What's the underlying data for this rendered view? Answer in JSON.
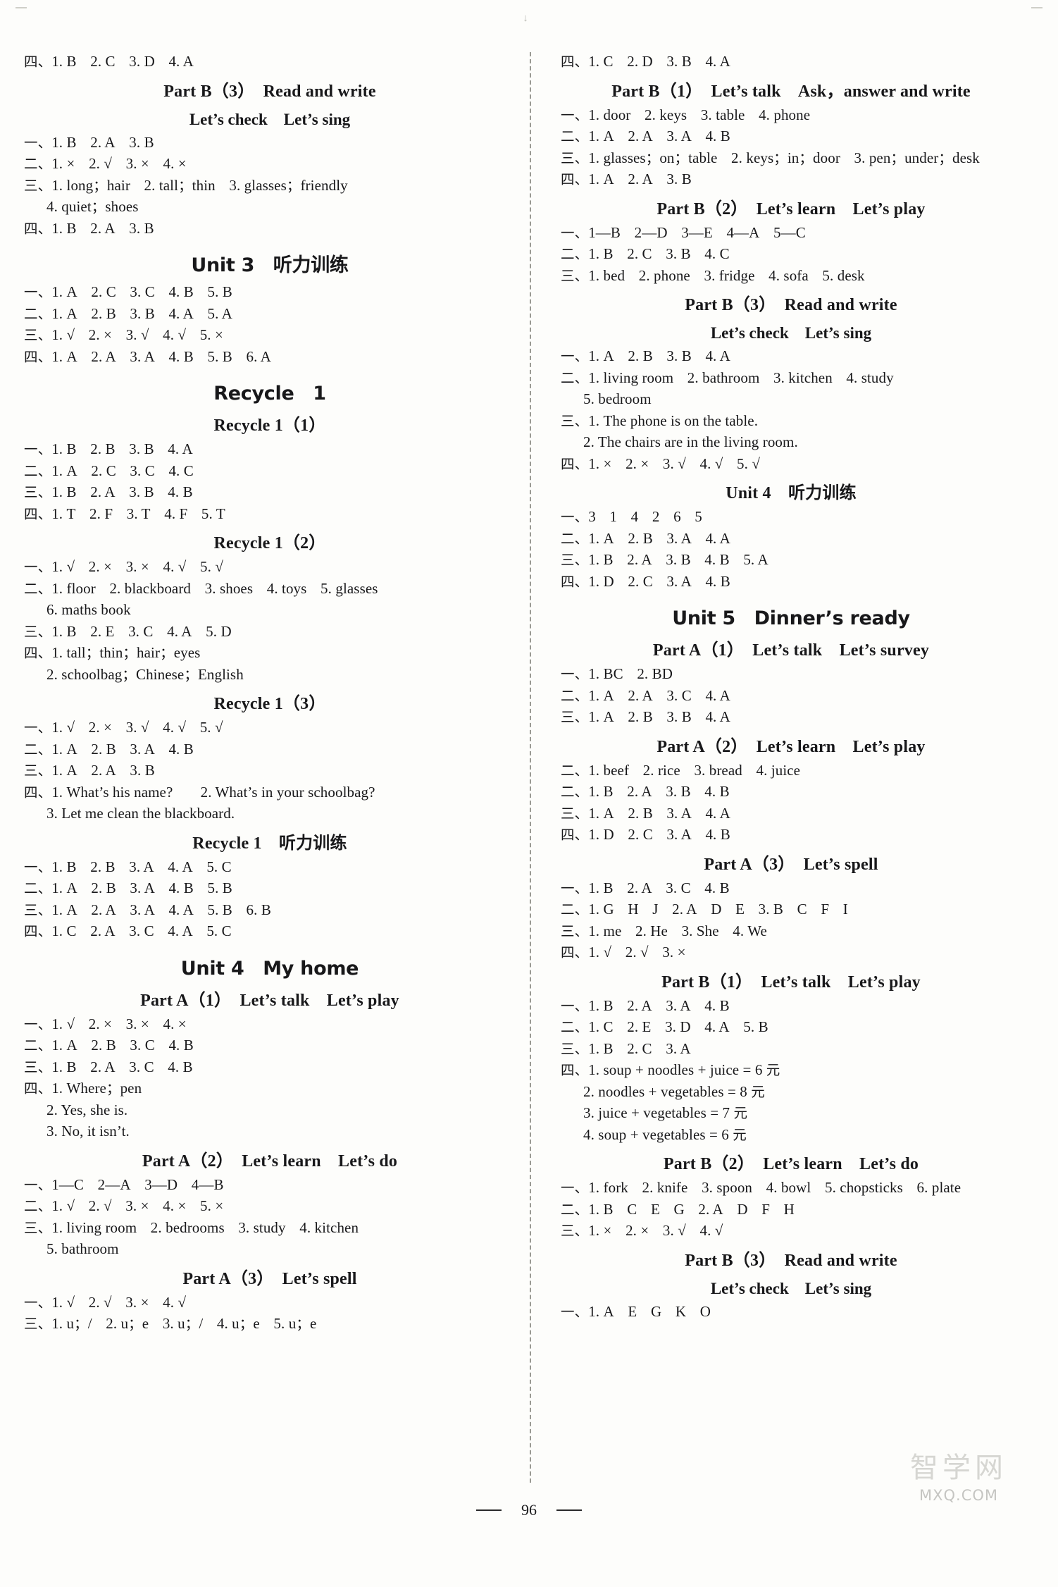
{
  "page": {
    "number": "96",
    "top_mark": "↓",
    "watermark_cn": "智学网",
    "watermark_url": "MXQ.COM"
  },
  "left_column": [
    {
      "kind": "answer",
      "text": "四、1. B　2. C　3. D　4. A"
    },
    {
      "kind": "heading_part",
      "text": "Part B（3）　Read and write"
    },
    {
      "kind": "heading_sub",
      "text": "Let’s check　Let’s sing"
    },
    {
      "kind": "answer",
      "text": "一、1. B　2. A　3. B"
    },
    {
      "kind": "answer",
      "text": "二、1. ×　2. √　3. ×　4. ×"
    },
    {
      "kind": "answer",
      "text": "三、1. long；hair　2. tall；thin　3. glasses；friendly"
    },
    {
      "kind": "answer_indent",
      "text": "4. quiet；shoes"
    },
    {
      "kind": "answer",
      "text": "四、1. B　2. A　3. B"
    },
    {
      "kind": "heading_unit",
      "text": "Unit 3　听力训练"
    },
    {
      "kind": "answer",
      "text": "一、1. A　2. C　3. C　4. B　5. B"
    },
    {
      "kind": "answer",
      "text": "二、1. A　2. B　3. B　4. A　5. A"
    },
    {
      "kind": "answer",
      "text": "三、1. √　2. ×　3. √　4. √　5. ×"
    },
    {
      "kind": "answer",
      "text": "四、1. A　2. A　3. A　4. B　5. B　6. A"
    },
    {
      "kind": "heading_unit",
      "text": "Recycle　1"
    },
    {
      "kind": "heading_part",
      "text": "Recycle 1（1）"
    },
    {
      "kind": "answer",
      "text": "一、1. B　2. B　3. B　4. A"
    },
    {
      "kind": "answer",
      "text": "二、1. A　2. C　3. C　4. C"
    },
    {
      "kind": "answer",
      "text": "三、1. B　2. A　3. B　4. B"
    },
    {
      "kind": "answer",
      "text": "四、1. T　2. F　3. T　4. F　5. T"
    },
    {
      "kind": "heading_part",
      "text": "Recycle 1（2）"
    },
    {
      "kind": "answer",
      "text": "一、1. √　2. ×　3. ×　4. √　5. √"
    },
    {
      "kind": "answer",
      "text": "二、1. floor　2. blackboard　3. shoes　4. toys　5. glasses"
    },
    {
      "kind": "answer_indent",
      "text": "6. maths book"
    },
    {
      "kind": "answer",
      "text": "三、1. B　2. E　3. C　4. A　5. D"
    },
    {
      "kind": "answer",
      "text": "四、1. tall；thin；hair；eyes"
    },
    {
      "kind": "answer_indent",
      "text": "2. schoolbag；Chinese；English"
    },
    {
      "kind": "heading_part",
      "text": "Recycle 1（3）"
    },
    {
      "kind": "answer",
      "text": "一、1. √　2. ×　3. √　4. √　5. √"
    },
    {
      "kind": "answer",
      "text": "二、1. A　2. B　3. A　4. B"
    },
    {
      "kind": "answer",
      "text": "三、1. A　2. A　3. B"
    },
    {
      "kind": "answer",
      "text": "四、1. What’s his name?　　2. What’s in your schoolbag?"
    },
    {
      "kind": "answer_indent",
      "text": "3. Let me clean the blackboard."
    },
    {
      "kind": "heading_part",
      "text": "Recycle 1　听力训练"
    },
    {
      "kind": "answer",
      "text": "一、1. B　2. B　3. A　4. A　5. C"
    },
    {
      "kind": "answer",
      "text": "二、1. A　2. B　3. A　4. B　5. B"
    },
    {
      "kind": "answer",
      "text": "三、1. A　2. A　3. A　4. A　5. B　6. B"
    },
    {
      "kind": "answer",
      "text": "四、1. C　2. A　3. C　4. A　5. C"
    },
    {
      "kind": "heading_unit",
      "text": "Unit 4　My home"
    },
    {
      "kind": "heading_part",
      "text": "Part A（1）　Let’s talk　Let’s play"
    },
    {
      "kind": "answer",
      "text": "一、1. √　2. ×　3. ×　4. ×"
    },
    {
      "kind": "answer",
      "text": "二、1. A　2. B　3. C　4. B"
    },
    {
      "kind": "answer",
      "text": "三、1. B　2. A　3. C　4. B"
    },
    {
      "kind": "answer",
      "text": "四、1. Where；pen"
    },
    {
      "kind": "answer_indent",
      "text": "2. Yes, she is."
    },
    {
      "kind": "answer_indent",
      "text": "3. No, it isn’t."
    },
    {
      "kind": "heading_part",
      "text": "Part A（2）　Let’s learn　Let’s do"
    },
    {
      "kind": "answer",
      "text": "一、1—C　2—A　3—D　4—B"
    },
    {
      "kind": "answer",
      "text": "二、1. √　2. √　3. ×　4. ×　5. ×"
    },
    {
      "kind": "answer",
      "text": "三、1. living room　2. bedrooms　3. study　4. kitchen"
    },
    {
      "kind": "answer_indent",
      "text": "5. bathroom"
    },
    {
      "kind": "heading_part",
      "text": "Part A（3）　Let’s spell"
    },
    {
      "kind": "answer",
      "text": "一、1. √　2. √　3. ×　4. √"
    },
    {
      "kind": "answer",
      "text": "三、1. u；/　2. u；e　3. u；/　4. u；e　5. u；e"
    }
  ],
  "right_column": [
    {
      "kind": "answer",
      "text": "四、1. C　2. D　3. B　4. A"
    },
    {
      "kind": "heading_part",
      "text": "Part B（1）　Let’s talk　Ask，answer and write"
    },
    {
      "kind": "answer",
      "text": "一、1. door　2. keys　3. table　4. phone"
    },
    {
      "kind": "answer",
      "text": "二、1. A　2. A　3. A　4. B"
    },
    {
      "kind": "answer",
      "text": "三、1. glasses；on；table　2. keys；in；door　3. pen；under；desk"
    },
    {
      "kind": "answer",
      "text": "四、1. A　2. A　3. B"
    },
    {
      "kind": "heading_part",
      "text": "Part B（2）　Let’s learn　Let’s play"
    },
    {
      "kind": "answer",
      "text": "一、1—B　2—D　3—E　4—A　5—C"
    },
    {
      "kind": "answer",
      "text": "二、1. B　2. C　3. B　4. C"
    },
    {
      "kind": "answer",
      "text": "三、1. bed　2. phone　3. fridge　4. sofa　5. desk"
    },
    {
      "kind": "heading_part",
      "text": "Part B（3）　Read and write"
    },
    {
      "kind": "heading_sub",
      "text": "Let’s check　Let’s sing"
    },
    {
      "kind": "answer",
      "text": "一、1. A　2. B　3. B　4. A"
    },
    {
      "kind": "answer",
      "text": "二、1. living room　2. bathroom　3. kitchen　4. study"
    },
    {
      "kind": "answer_indent",
      "text": "5. bedroom"
    },
    {
      "kind": "answer",
      "text": "三、1. The phone is on the table."
    },
    {
      "kind": "answer_indent",
      "text": "2. The chairs are in the living room."
    },
    {
      "kind": "answer",
      "text": "四、1. ×　2. ×　3. √　4. √　5. √"
    },
    {
      "kind": "heading_part",
      "text": "Unit 4　听力训练"
    },
    {
      "kind": "answer",
      "text": "一、3　1　4　2　6　5"
    },
    {
      "kind": "answer",
      "text": "二、1. A　2. B　3. A　4. A"
    },
    {
      "kind": "answer",
      "text": "三、1. B　2. A　3. B　4. B　5. A"
    },
    {
      "kind": "answer",
      "text": "四、1. D　2. C　3. A　4. B"
    },
    {
      "kind": "heading_unit",
      "text": "Unit 5　Dinner’s ready"
    },
    {
      "kind": "heading_part",
      "text": "Part A（1）　Let’s talk　Let’s survey"
    },
    {
      "kind": "answer",
      "text": "一、1. BC　2. BD"
    },
    {
      "kind": "answer",
      "text": "二、1. A　2. A　3. C　4. A"
    },
    {
      "kind": "answer",
      "text": "三、1. A　2. B　3. B　4. A"
    },
    {
      "kind": "heading_part",
      "text": "Part A（2）　Let’s learn　Let’s play"
    },
    {
      "kind": "answer",
      "text": "二、1. beef　2. rice　3. bread　4. juice"
    },
    {
      "kind": "answer",
      "text": "二、1. B　2. A　3. B　4. B"
    },
    {
      "kind": "answer",
      "text": "三、1. A　2. B　3. A　4. A"
    },
    {
      "kind": "answer",
      "text": "四、1. D　2. C　3. A　4. B"
    },
    {
      "kind": "heading_part",
      "text": "Part A（3）　Let’s spell"
    },
    {
      "kind": "answer",
      "text": "一、1. B　2. A　3. C　4. B"
    },
    {
      "kind": "answer",
      "text": "二、1. G　H　J　2. A　D　E　3. B　C　F　I"
    },
    {
      "kind": "answer",
      "text": "三、1. me　2. He　3. She　4. We"
    },
    {
      "kind": "answer",
      "text": "四、1. √　2. √　3. ×"
    },
    {
      "kind": "heading_part",
      "text": "Part B（1）　Let’s talk　Let’s play"
    },
    {
      "kind": "answer",
      "text": "一、1. B　2. A　3. A　4. B"
    },
    {
      "kind": "answer",
      "text": "二、1. C　2. E　3. D　4. A　5. B"
    },
    {
      "kind": "answer",
      "text": "三、1. B　2. C　3. A"
    },
    {
      "kind": "answer",
      "text": "四、1. soup + noodles + juice = 6 元"
    },
    {
      "kind": "answer_indent",
      "text": "2. noodles + vegetables = 8 元"
    },
    {
      "kind": "answer_indent",
      "text": "3. juice + vegetables = 7 元"
    },
    {
      "kind": "answer_indent",
      "text": "4. soup + vegetables = 6 元"
    },
    {
      "kind": "heading_part",
      "text": "Part B（2）　Let’s learn　Let’s do"
    },
    {
      "kind": "answer",
      "text": "一、1. fork　2. knife　3. spoon　4. bowl　5. chopsticks　6. plate"
    },
    {
      "kind": "answer",
      "text": "二、1. B　C　E　G　2. A　D　F　H"
    },
    {
      "kind": "answer",
      "text": "三、1. ×　2. ×　3. √　4. √"
    },
    {
      "kind": "heading_part",
      "text": "Part B（3）　Read and write"
    },
    {
      "kind": "heading_sub",
      "text": "Let’s check　Let’s sing"
    },
    {
      "kind": "answer",
      "text": "一、1. A　E　G　K　O"
    }
  ]
}
